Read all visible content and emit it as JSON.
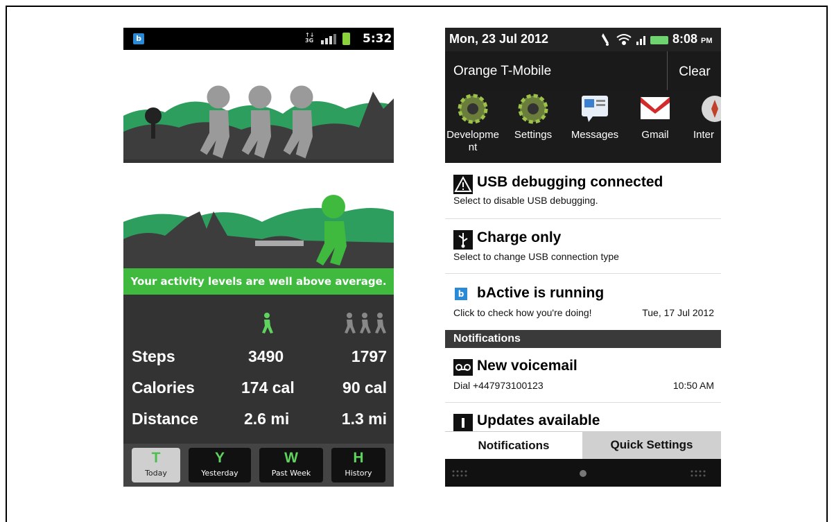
{
  "left_phone": {
    "status_bar": {
      "app_icon_letter": "b",
      "network": "3G",
      "time": "5:32"
    },
    "banner": "Your activity levels are well above average.",
    "stats": [
      {
        "label": "Steps",
        "you": "3490",
        "average": "1797"
      },
      {
        "label": "Calories",
        "you": "174 cal",
        "average": "90 cal"
      },
      {
        "label": "Distance",
        "you": "2.6 mi",
        "average": "1.3 mi"
      }
    ],
    "tabs": [
      {
        "letter": "T",
        "label": "Today",
        "active": true
      },
      {
        "letter": "Y",
        "label": "Yesterday",
        "active": false
      },
      {
        "letter": "W",
        "label": "Past Week",
        "active": false
      },
      {
        "letter": "H",
        "label": "History",
        "active": false
      }
    ],
    "colors": {
      "accent": "#3fba3f",
      "hills": "#2e9e5e",
      "silhouette": "#3d3d3d"
    }
  },
  "right_phone": {
    "status_bar": {
      "date": "Mon, 23 Jul 2012",
      "time": "8:08",
      "ampm": "PM"
    },
    "carrier": "Orange T-Mobile",
    "clear_label": "Clear",
    "apps": [
      {
        "label_line1": "Developme",
        "label_line2": "nt",
        "icon": "gear-icon"
      },
      {
        "label_line1": "Settings",
        "label_line2": "",
        "icon": "gear-icon"
      },
      {
        "label_line1": "Messages",
        "label_line2": "",
        "icon": "messages-icon"
      },
      {
        "label_line1": "Gmail",
        "label_line2": "",
        "icon": "gmail-icon"
      },
      {
        "label_line1": "Inter",
        "label_line2": "",
        "icon": "internet-icon"
      }
    ],
    "ongoing": [
      {
        "title": "USB debugging connected",
        "subtitle": "Select to disable USB debugging.",
        "time": "",
        "icon": "warning-icon"
      },
      {
        "title": "Charge only",
        "subtitle": "Select to change USB connection type",
        "time": "",
        "icon": "usb-icon"
      },
      {
        "title": "bActive is running",
        "subtitle": "Click to check how you're doing!",
        "time": "Tue, 17 Jul 2012",
        "icon": "bactive-icon"
      }
    ],
    "section_header": "Notifications",
    "notifications": [
      {
        "title": "New voicemail",
        "subtitle": "Dial +447973100123",
        "time": "10:50 AM",
        "icon": "voicemail-icon"
      },
      {
        "title": "Updates available",
        "subtitle": "",
        "time": "",
        "icon": "updates-icon"
      }
    ],
    "bottom_tabs": [
      {
        "label": "Notifications",
        "active": true
      },
      {
        "label": "Quick Settings",
        "active": false
      }
    ]
  }
}
